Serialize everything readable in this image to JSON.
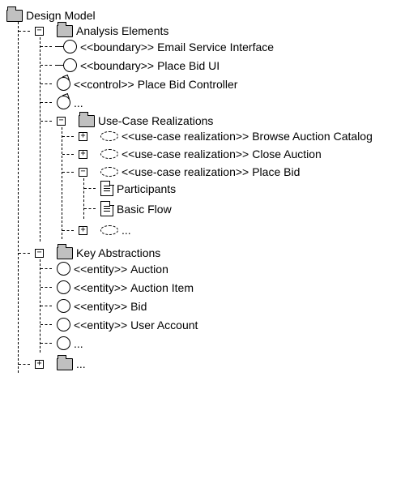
{
  "tree": {
    "root": {
      "label": "Design Model",
      "children": {
        "analysis": {
          "label": "Analysis Elements",
          "items": [
            {
              "stereo": "<<boundary>>",
              "name": "Email Service Interface"
            },
            {
              "stereo": "<<boundary>>",
              "name": "Place Bid UI"
            },
            {
              "stereo": "<<control>>",
              "name": "Place Bid Controller"
            },
            {
              "stereo": "",
              "name": "..."
            }
          ],
          "ucr": {
            "label": "Use-Case Realizations",
            "items": [
              {
                "stereo": "<<use-case realization>>",
                "name": "Browse Auction Catalog"
              },
              {
                "stereo": "<<use-case realization>>",
                "name": "Close Auction"
              },
              {
                "stereo": "<<use-case realization>>",
                "name": "Place Bid"
              }
            ],
            "placebid_children": [
              {
                "label": "Participants"
              },
              {
                "label": "Basic Flow"
              }
            ],
            "more": "..."
          }
        },
        "key": {
          "label": "Key Abstractions",
          "items": [
            {
              "stereo": "<<entity>>",
              "name": "Auction"
            },
            {
              "stereo": "<<entity>>",
              "name": "Auction Item"
            },
            {
              "stereo": "<<entity>>",
              "name": "Bid"
            },
            {
              "stereo": "<<entity>>",
              "name": "User Account"
            },
            {
              "stereo": "",
              "name": "..."
            }
          ]
        },
        "more": "..."
      }
    }
  },
  "toggles": {
    "minus": "−",
    "plus": "+"
  }
}
